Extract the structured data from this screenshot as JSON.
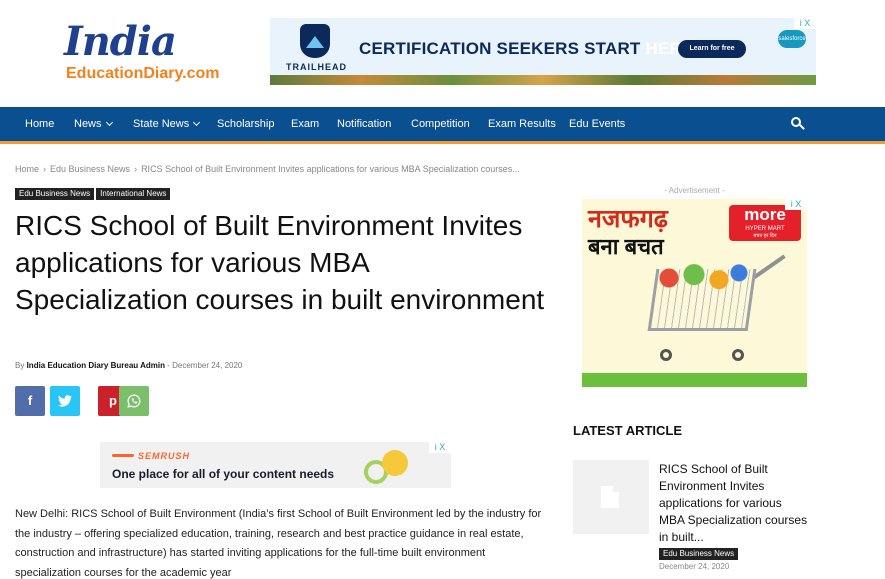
{
  "logo": {
    "line1": "India",
    "line2": "EducationDiary.com"
  },
  "top_ad": {
    "brand": "TRAILHEAD",
    "headline_main": "CERTIFICATION SEEKERS START",
    "headline_highlight": "HERE.",
    "cta": "Learn for free",
    "sponsor": "salesforce",
    "ad_choice": "i X"
  },
  "nav": {
    "items": [
      "Home",
      "News",
      "State News",
      "Scholarship",
      "Exam",
      "Notification",
      "Competition",
      "Exam Results",
      "Edu Events"
    ]
  },
  "breadcrumb": [
    "Home",
    "Edu Business News",
    "RICS School of Built Environment Invites applications for various MBA Specialization courses..."
  ],
  "tags": [
    "Edu Business News",
    "International News"
  ],
  "article": {
    "title": "RICS School of Built Environment Invites applications for various MBA Specialization courses in built environment",
    "by": "By",
    "author": "India Education Diary Bureau Admin",
    "date_sep": "-",
    "date": "December 24, 2020",
    "body": "New Delhi: RICS School of Built Environment (India’s first School of Built Environment led by the industry for the industry – offering specialized education, training, research and best practice guidance in real estate, construction and infrastructure) has started inviting applications for the full-time built environment specialization courses for the academic year"
  },
  "share": {
    "facebook": "f",
    "twitter": "t",
    "pinterest": "p",
    "whatsapp": "w"
  },
  "mid_ad": {
    "brand": "SEMRUSH",
    "copy": "One place for all of your content needs",
    "ad_choice": "i X"
  },
  "sidebar": {
    "ad_label": "- Advertisement -",
    "ad": {
      "line1": "नजफगढ़",
      "line2": "बना बचत",
      "brand": "more",
      "brand_sub": "HYPER MART",
      "brand_tag": "बचत हर दिन",
      "ad_choice": "i X"
    },
    "latest_heading": "LATEST ARTICLE",
    "latest": {
      "title": "RICS School of Built Environment Invites applications for various MBA Specialization courses in built...",
      "tag": "Edu Business News",
      "date": "December 24, 2020"
    }
  },
  "colors": {
    "nav_bg": "#0a4f8f",
    "nav_border": "#f39c32",
    "facebook": "#516eab",
    "twitter": "#29c5f6",
    "pinterest": "#ca212a",
    "whatsapp": "#7bbf6a"
  }
}
